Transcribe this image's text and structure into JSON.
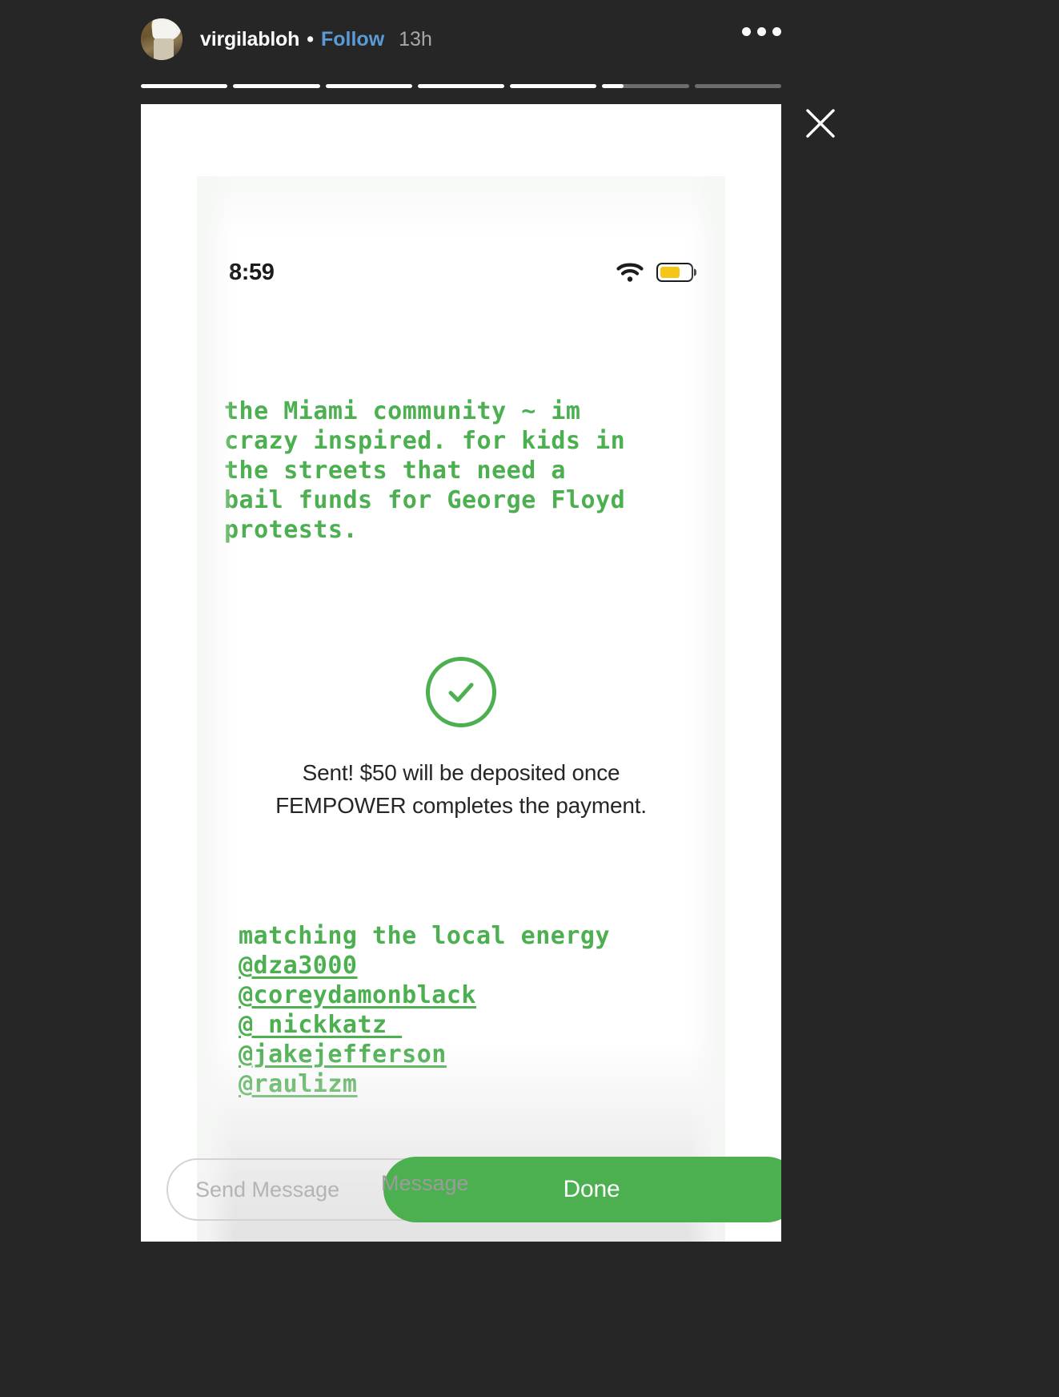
{
  "story": {
    "header": {
      "username": "virgilabloh",
      "separator": "•",
      "follow_label": "Follow",
      "timestamp": "13h",
      "more_options_label": "More options",
      "avatar_name": "virgilabloh-avatar"
    },
    "progress": {
      "segment_count": 7,
      "segments_fill_percent": [
        100,
        100,
        100,
        100,
        100,
        25,
        0
      ],
      "active_color": "#ffffff",
      "track_color": "#6d6d6d"
    },
    "close_label": "×"
  },
  "inner_screenshot": {
    "status_bar": {
      "time": "8:59",
      "wifi_icon": "wifi-icon",
      "battery_icon": "battery-icon",
      "battery_level_percent": 62,
      "battery_color": "#f5c518"
    },
    "caption_top": "the Miami community ~ im crazy inspired. for kids in the streets that need a bail funds for George Floyd protests.",
    "caption_top_lines": [
      "the Miami community ~ im",
      "crazy inspired. for kids in",
      "the streets that need a",
      "bail funds for George Floyd",
      "protests."
    ],
    "payment": {
      "check_icon": "check-circle-icon",
      "message": "Sent! $50 will be deposited once FEMPOWER completes the payment.",
      "message_lines": [
        "Sent! $50 will be deposited once",
        "FEMPOWER completes the payment."
      ],
      "amount": "$50",
      "recipient": "FEMPOWER",
      "accent_color": "#4caf50"
    },
    "caption_bottom_heading": "matching the local energy",
    "mentions": [
      "@dza3000",
      "@coreydamonblack",
      "@_nickkatz_",
      "@jakejefferson",
      "@raulizm"
    ],
    "done_button_label": "Done",
    "text_color": "#4caf50"
  },
  "reply_bar": {
    "placeholder": "Send Message",
    "placeholder_prefix": "Send",
    "placeholder_suffix": "Message",
    "send_icon": "paper-plane-icon"
  }
}
